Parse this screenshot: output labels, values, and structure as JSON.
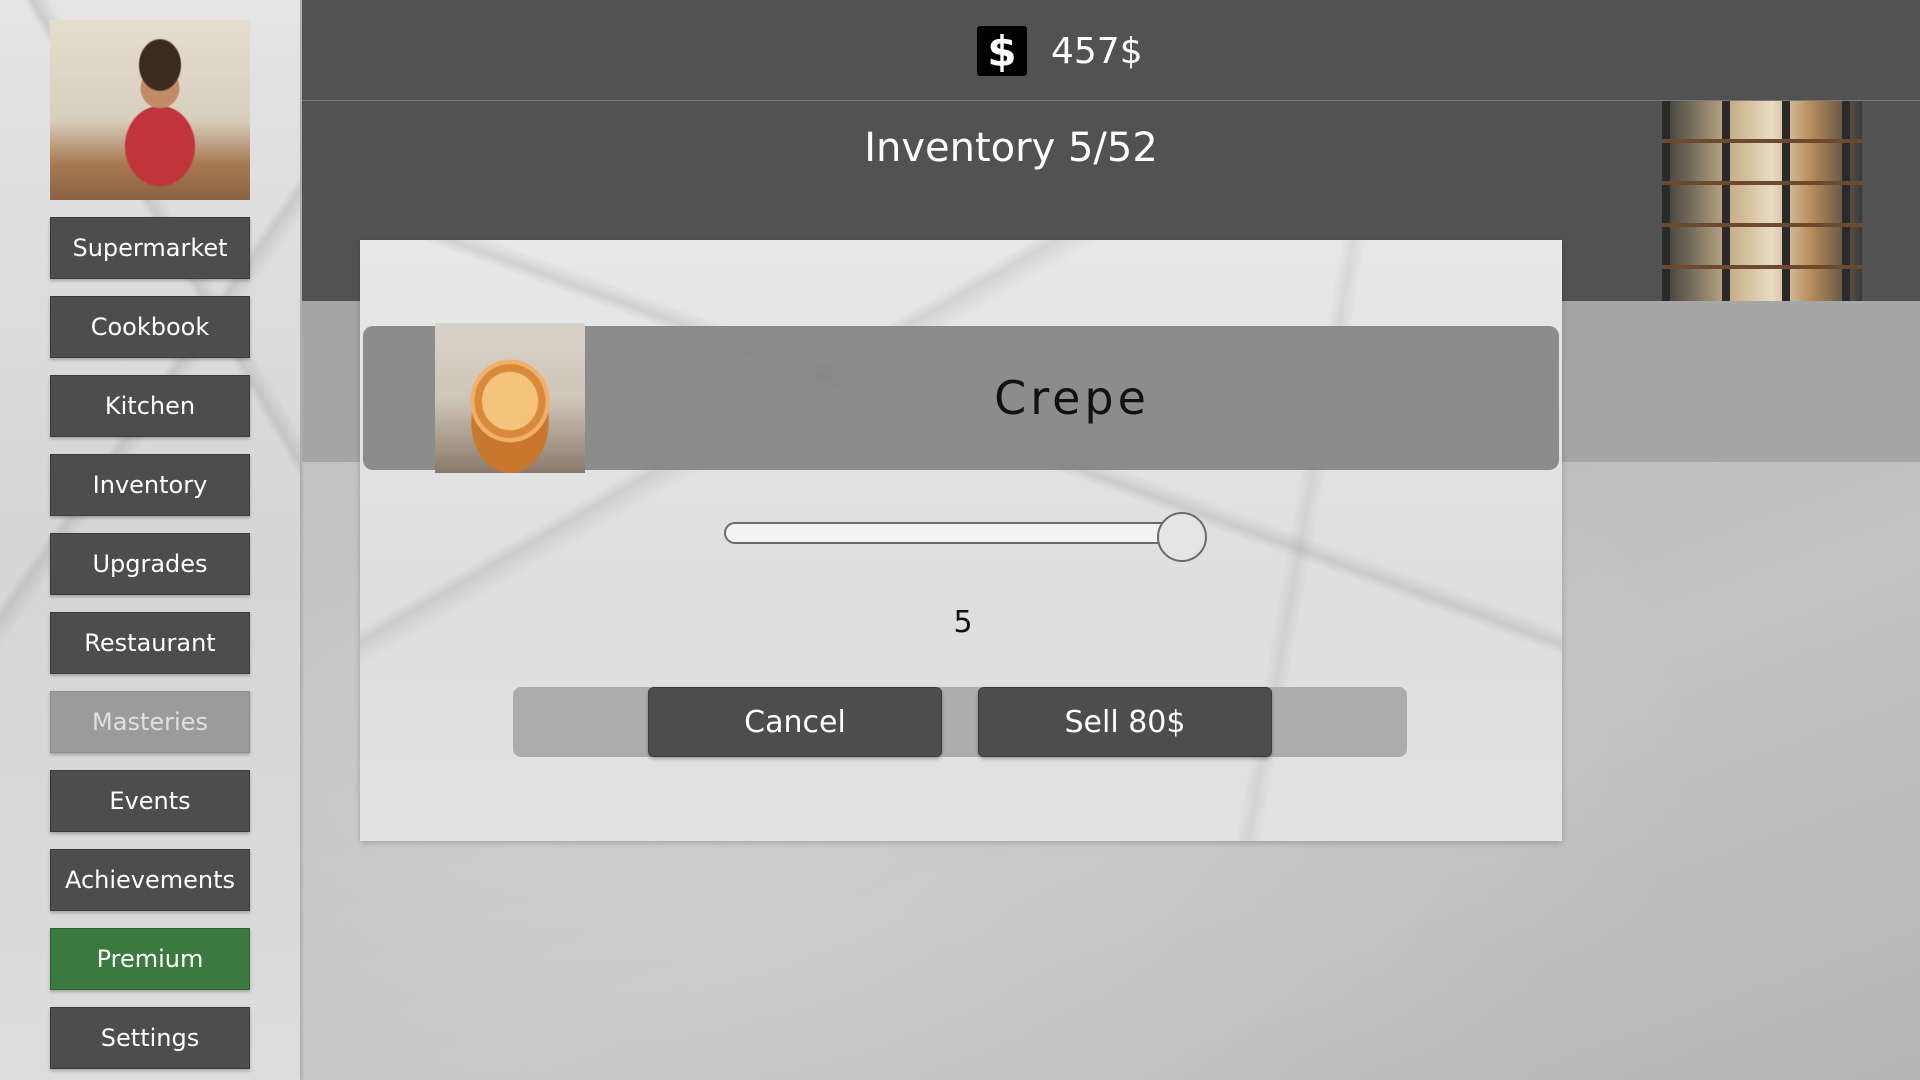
{
  "header": {
    "money_icon": "dollar-sign-icon",
    "money": "457$"
  },
  "inventory": {
    "title": "Inventory 5/52"
  },
  "sidebar": {
    "items": [
      {
        "label": "Supermarket",
        "state": "normal"
      },
      {
        "label": "Cookbook",
        "state": "normal"
      },
      {
        "label": "Kitchen",
        "state": "normal"
      },
      {
        "label": "Inventory",
        "state": "normal"
      },
      {
        "label": "Upgrades",
        "state": "normal"
      },
      {
        "label": "Restaurant",
        "state": "normal"
      },
      {
        "label": "Masteries",
        "state": "disabled"
      },
      {
        "label": "Events",
        "state": "normal"
      },
      {
        "label": "Achievements",
        "state": "normal"
      },
      {
        "label": "Premium",
        "state": "highlight"
      },
      {
        "label": "Settings",
        "state": "normal"
      }
    ]
  },
  "dialog": {
    "item_name": "Crepe",
    "quantity_slider": {
      "min": 0,
      "max": 5,
      "value": 5
    },
    "quantity": "5",
    "cancel_label": "Cancel",
    "sell_label": "Sell 80$"
  },
  "colors": {
    "bar": "#525252",
    "button": "#4d4d4d",
    "premium": "#3a7a3f",
    "disabled": "#9b9b9b"
  }
}
